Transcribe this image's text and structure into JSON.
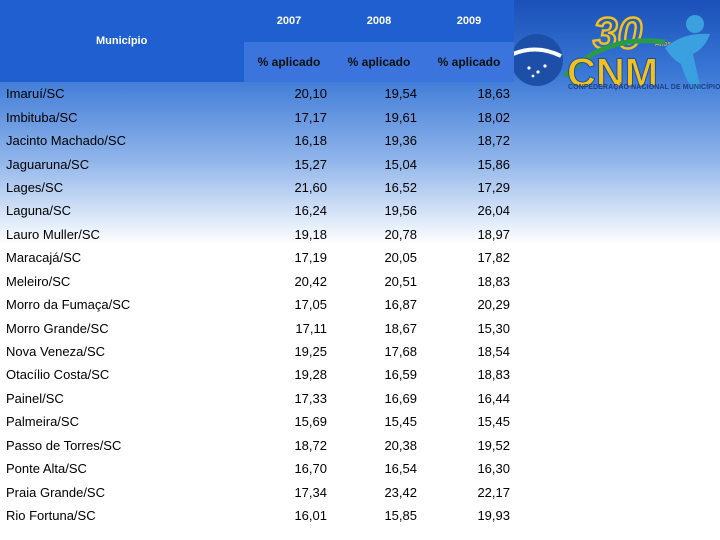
{
  "header": {
    "municipio_label": "Município",
    "years": [
      "2007",
      "2008",
      "2009"
    ],
    "sub_labels": [
      "% aplicado",
      "% aplicado",
      "% aplicado"
    ]
  },
  "logo": {
    "number": "30",
    "anos": "Anos",
    "brand": "CNM",
    "subtitle": "CONFEDERAÇÃO NACIONAL DE MUNICÍPIOS",
    "colors": {
      "blue": "#1e4fa8",
      "yellow": "#f2c21a",
      "green": "#2a9a48"
    }
  },
  "rows": [
    {
      "municipio": "Imaruí/SC",
      "v2007": "20,10",
      "v2008": "19,54",
      "v2009": "18,63"
    },
    {
      "municipio": "Imbituba/SC",
      "v2007": "17,17",
      "v2008": "19,61",
      "v2009": "18,02"
    },
    {
      "municipio": "Jacinto Machado/SC",
      "v2007": "16,18",
      "v2008": "19,36",
      "v2009": "18,72"
    },
    {
      "municipio": "Jaguaruna/SC",
      "v2007": "15,27",
      "v2008": "15,04",
      "v2009": "15,86"
    },
    {
      "municipio": "Lages/SC",
      "v2007": "21,60",
      "v2008": "16,52",
      "v2009": "17,29"
    },
    {
      "municipio": "Laguna/SC",
      "v2007": "16,24",
      "v2008": "19,56",
      "v2009": "26,04"
    },
    {
      "municipio": "Lauro Muller/SC",
      "v2007": "19,18",
      "v2008": "20,78",
      "v2009": "18,97"
    },
    {
      "municipio": "Maracajá/SC",
      "v2007": "17,19",
      "v2008": "20,05",
      "v2009": "17,82"
    },
    {
      "municipio": "Meleiro/SC",
      "v2007": "20,42",
      "v2008": "20,51",
      "v2009": "18,83"
    },
    {
      "municipio": "Morro da Fumaça/SC",
      "v2007": "17,05",
      "v2008": "16,87",
      "v2009": "20,29"
    },
    {
      "municipio": "Morro Grande/SC",
      "v2007": "17,11",
      "v2008": "18,67",
      "v2009": "15,30"
    },
    {
      "municipio": "Nova Veneza/SC",
      "v2007": "19,25",
      "v2008": "17,68",
      "v2009": "18,54"
    },
    {
      "municipio": "Otacílio Costa/SC",
      "v2007": "19,28",
      "v2008": "16,59",
      "v2009": "18,83"
    },
    {
      "municipio": "Painel/SC",
      "v2007": "17,33",
      "v2008": "16,69",
      "v2009": "16,44"
    },
    {
      "municipio": "Palmeira/SC",
      "v2007": "15,69",
      "v2008": "15,45",
      "v2009": "15,45"
    },
    {
      "municipio": "Passo de Torres/SC",
      "v2007": "18,72",
      "v2008": "20,38",
      "v2009": "19,52"
    },
    {
      "municipio": "Ponte Alta/SC",
      "v2007": "16,70",
      "v2008": "16,54",
      "v2009": "16,30"
    },
    {
      "municipio": "Praia Grande/SC",
      "v2007": "17,34",
      "v2008": "23,42",
      "v2009": "22,17"
    },
    {
      "municipio": "Rio Fortuna/SC",
      "v2007": "16,01",
      "v2008": "15,85",
      "v2009": "19,93"
    }
  ]
}
